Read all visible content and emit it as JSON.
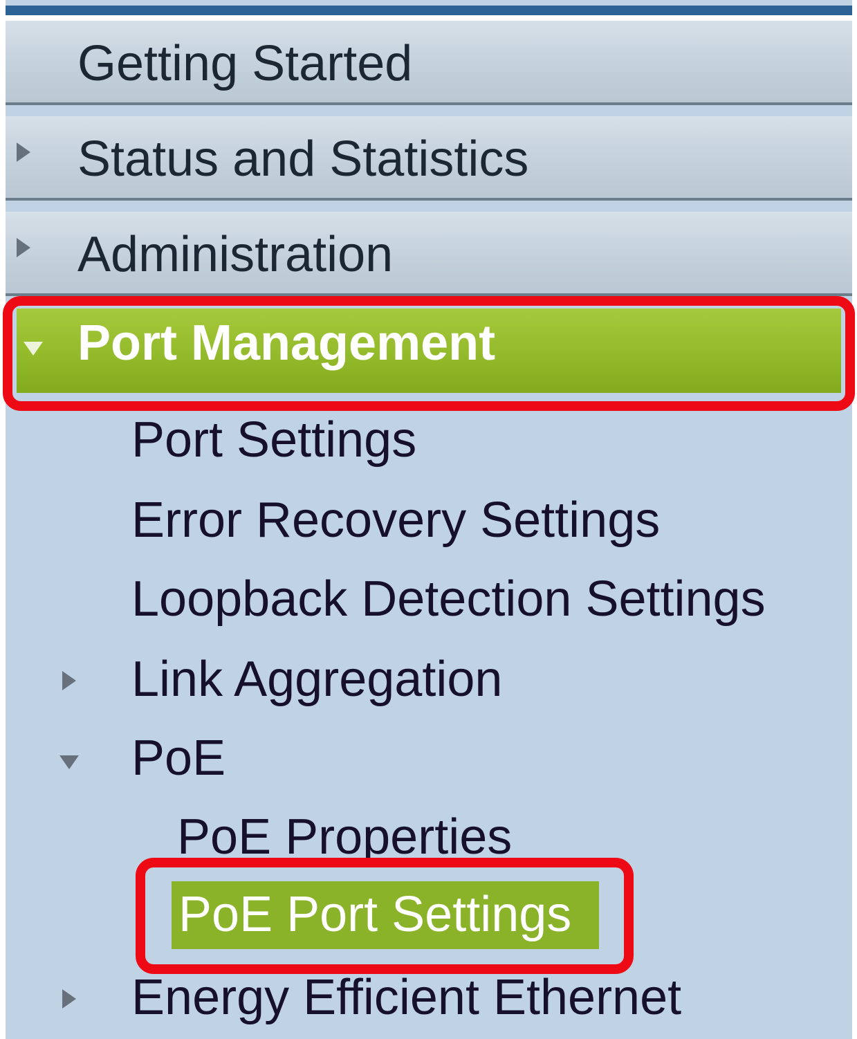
{
  "menu": {
    "top_items": [
      {
        "label": "Getting Started",
        "expander": "none"
      },
      {
        "label": "Status and Statistics",
        "expander": "collapsed-arrow-icon"
      },
      {
        "label": "Administration",
        "expander": "collapsed-arrow-icon"
      }
    ],
    "active_section": {
      "label": "Port Management",
      "expander": "expanded-arrow-icon",
      "children": [
        {
          "label": "Port Settings"
        },
        {
          "label": "Error Recovery Settings"
        },
        {
          "label": "Loopback Detection Settings"
        },
        {
          "label": "Link Aggregation",
          "expander": "collapsed-arrow-icon"
        },
        {
          "label": "PoE",
          "expander": "expanded-arrow-icon",
          "children": [
            {
              "label": "PoE Properties"
            },
            {
              "label": "PoE Port Settings",
              "selected": true
            }
          ]
        },
        {
          "label": "Energy Efficient Ethernet",
          "expander": "collapsed-arrow-icon"
        }
      ]
    }
  },
  "colors": {
    "top_bar": "#2d6297",
    "menu_background": "#c0d3e5",
    "active_green": "#95bc2c",
    "highlight_red": "#ee0a14",
    "text_dark": "#16102a",
    "text_active": "#ffffff"
  }
}
